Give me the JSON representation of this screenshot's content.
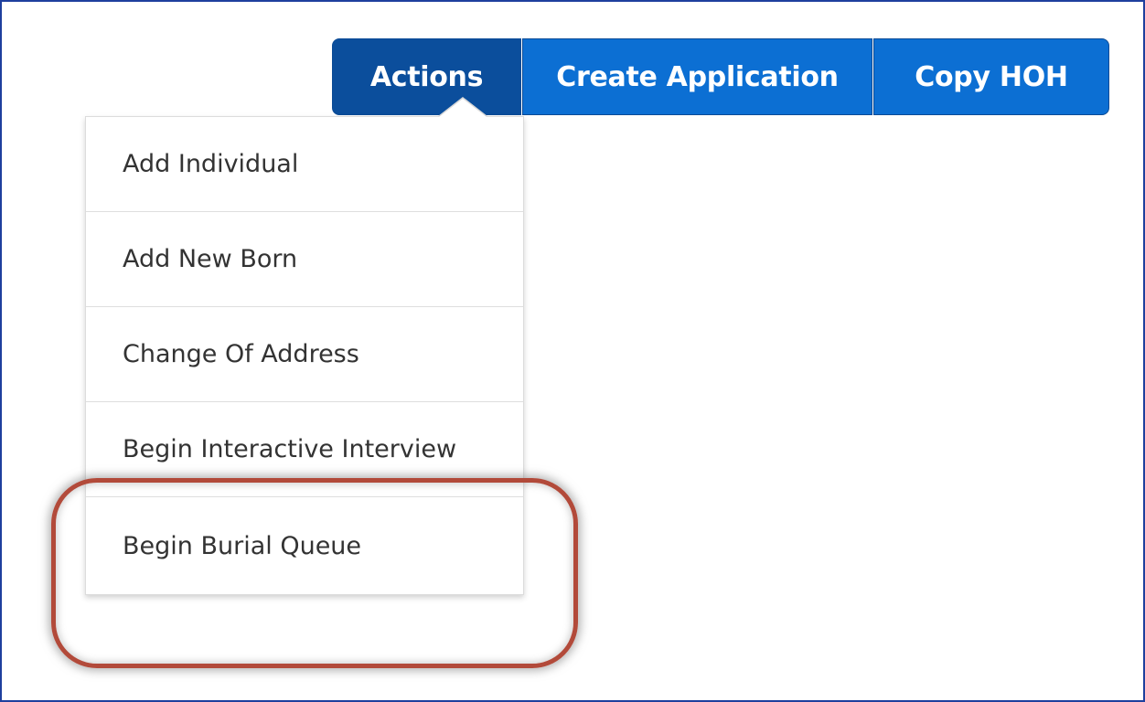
{
  "toolbar": {
    "actions_label": "Actions",
    "create_application_label": "Create Application",
    "copy_hoh_label": "Copy HOH"
  },
  "actions_menu": {
    "items": [
      {
        "label": "Add Individual"
      },
      {
        "label": "Add New Born"
      },
      {
        "label": "Change Of Address"
      },
      {
        "label": "Begin Interactive Interview"
      },
      {
        "label": "Begin Burial Queue"
      }
    ]
  },
  "colors": {
    "actions_button": "#0b4e9c",
    "primary_button": "#0c6fd3",
    "highlight_outline": "#b24a3a",
    "frame_border": "#1f3f9e"
  }
}
